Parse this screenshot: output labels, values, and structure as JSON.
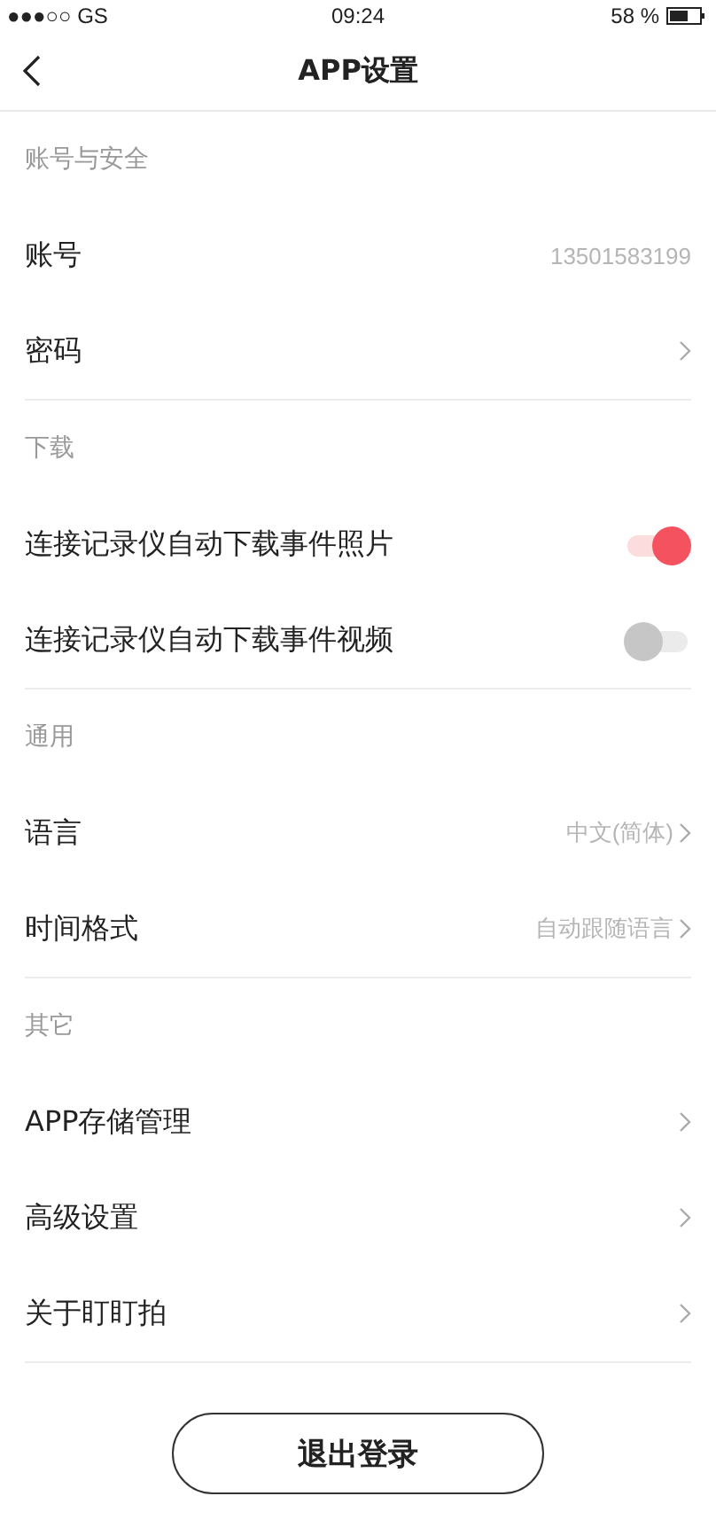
{
  "status_bar": {
    "carrier": "●●●○○ GS",
    "time": "09:24",
    "battery": "58 %"
  },
  "nav": {
    "title": "APP设置"
  },
  "sections": [
    {
      "title": "账号与安全",
      "items": [
        {
          "kind": "value",
          "label": "账号",
          "value": "13501583199"
        },
        {
          "kind": "link",
          "label": "密码"
        }
      ]
    },
    {
      "title": "下载",
      "items": [
        {
          "kind": "toggle",
          "label": "连接记录仪自动下载事件照片",
          "on": true
        },
        {
          "kind": "toggle",
          "label": "连接记录仪自动下载事件视频",
          "on": false
        }
      ]
    },
    {
      "title": "通用",
      "items": [
        {
          "kind": "link",
          "label": "语言",
          "value": "中文(简体)"
        },
        {
          "kind": "link",
          "label": "时间格式",
          "value": "自动跟随语言"
        }
      ]
    },
    {
      "title": "其它",
      "items": [
        {
          "kind": "link",
          "label": "APP存储管理"
        },
        {
          "kind": "link",
          "label": "高级设置"
        },
        {
          "kind": "link",
          "label": "关于盯盯拍"
        }
      ]
    }
  ],
  "logout_button": "退出登录"
}
